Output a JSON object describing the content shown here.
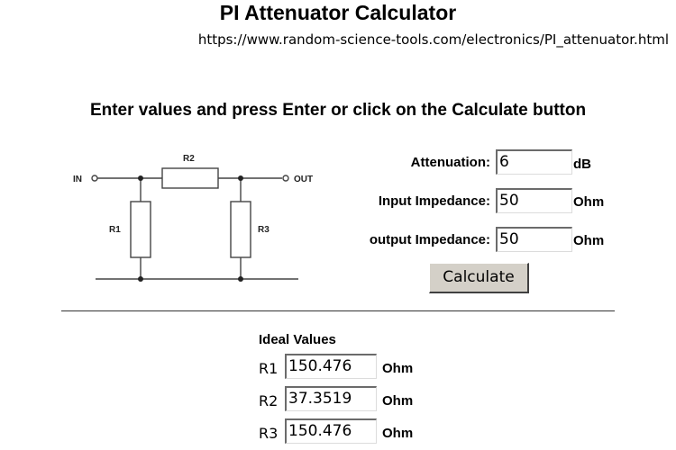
{
  "page": {
    "title": "PI Attenuator Calculator",
    "url": "https://www.random-science-tools.com/electronics/PI_attenuator.html"
  },
  "instruction": {
    "part1": "Enter values and press ",
    "key_enter": "Enter",
    "part2": " or click on the ",
    "key_calculate": "Calculate",
    "part3": " button"
  },
  "schematic": {
    "in_label": "IN",
    "out_label": "OUT",
    "r1_label": "R1",
    "r2_label": "R2",
    "r3_label": "R3"
  },
  "form": {
    "attenuation": {
      "label": "Attenuation:",
      "value": "6",
      "unit": "dB"
    },
    "input_impedance": {
      "label": "Input Impedance:",
      "value": "50",
      "unit": "Ohm"
    },
    "output_impedance": {
      "label": "output Impedance:",
      "value": "50",
      "unit": "Ohm"
    },
    "calculate_label": "Calculate"
  },
  "results": {
    "title": "Ideal Values",
    "r1": {
      "label": "R1",
      "value": "150.476",
      "unit": "Ohm"
    },
    "r2": {
      "label": "R2",
      "value": "37.3519",
      "unit": "Ohm"
    },
    "r3": {
      "label": "R3",
      "value": "150.476",
      "unit": "Ohm"
    }
  }
}
